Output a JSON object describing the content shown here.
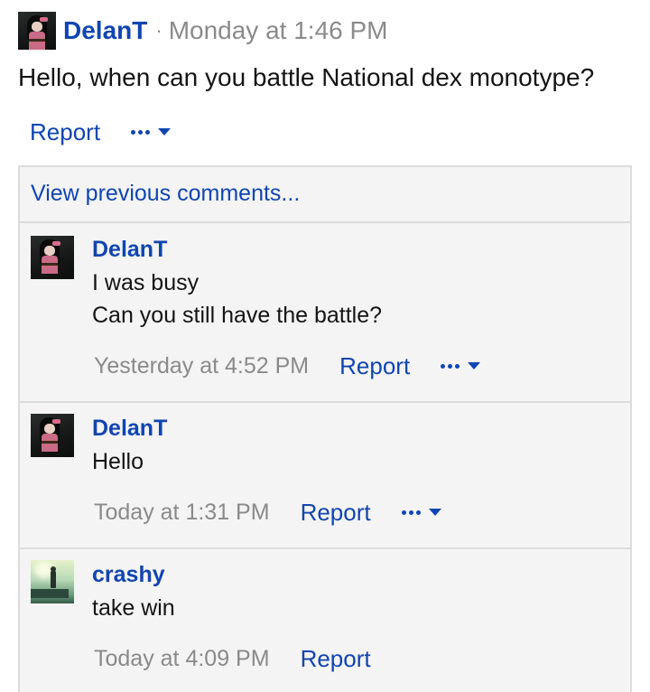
{
  "post": {
    "author": "DelanT",
    "separator": "·",
    "time": "Monday at 1:46 PM",
    "body": "Hello, when can you battle National dex monotype?",
    "report_label": "Report",
    "more_icon": "ellipsis-caret-icon"
  },
  "comments_section": {
    "view_previous_label": "View previous comments...",
    "items": [
      {
        "author": "DelanT",
        "lines": [
          "I was busy",
          "Can you still have the battle?"
        ],
        "time": "Yesterday at 4:52 PM",
        "report_label": "Report",
        "has_more_menu": true
      },
      {
        "author": "DelanT",
        "lines": [
          "Hello"
        ],
        "time": "Today at 1:31 PM",
        "report_label": "Report",
        "has_more_menu": true
      },
      {
        "author": "crashy",
        "lines": [
          "take win"
        ],
        "time": "Today at 4:09 PM",
        "report_label": "Report",
        "has_more_menu": false
      }
    ]
  },
  "colors": {
    "link": "#1045b1",
    "muted": "#8a8a8a",
    "comments_bg": "#f4f4f4",
    "border": "#dcdcdc"
  }
}
